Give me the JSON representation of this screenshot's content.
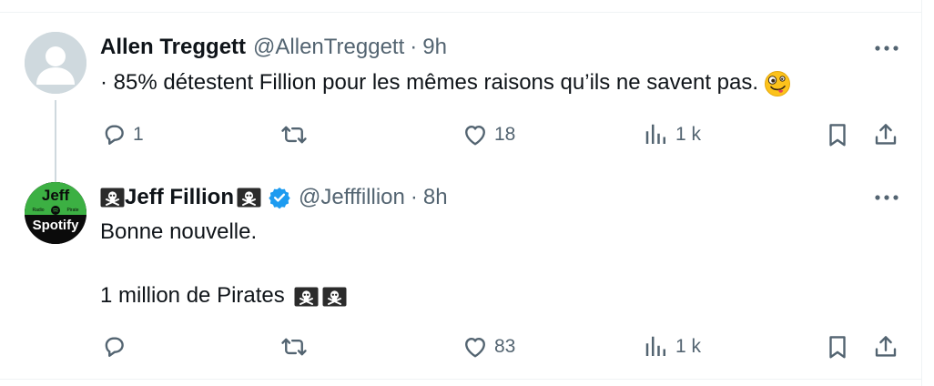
{
  "tweets": [
    {
      "name": "Allen Treggett",
      "handle": "@AllenTreggett",
      "separator": "·",
      "time": "9h",
      "text": "· 85% détestent Fillion pour les mêmes raisons qu’ils ne savent pas.",
      "text_emoji": "zany-face",
      "replies": "1",
      "retweets": "",
      "likes": "18",
      "views": "1 k"
    },
    {
      "name": "Jeff Fillion",
      "name_emoji": "pirate-flag",
      "verified": true,
      "avatar_text": [
        "Jeff",
        "Radio",
        "Pirate",
        "Spotify"
      ],
      "handle": "@Jefffillion",
      "separator": "·",
      "time": "8h",
      "lines": [
        "Bonne nouvelle.",
        "1 million de Pirates"
      ],
      "line_emoji": "pirate-flag",
      "replies": "",
      "retweets": "",
      "likes": "83",
      "views": "1 k"
    }
  ],
  "colors": {
    "text": "#0f1419",
    "secondary": "#536471",
    "verified": "#1d9bf0",
    "avatar_placeholder": "#cfd9de",
    "avatar_green": "#3cb043"
  },
  "icons": [
    "more-icon",
    "reply-icon",
    "retweet-icon",
    "like-icon",
    "views-icon",
    "bookmark-icon",
    "share-icon",
    "verified-icon",
    "pirate-flag-icon"
  ]
}
